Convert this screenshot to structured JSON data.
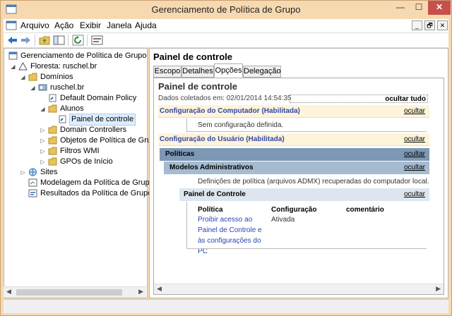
{
  "window": {
    "title": "Gerenciamento de Política de Grupo",
    "minimize": "—",
    "maximize": "☐",
    "close": "✕"
  },
  "menu": {
    "items": [
      "Arquivo",
      "Ação",
      "Exibir",
      "Janela",
      "Ajuda"
    ],
    "mdi_minimize": "_",
    "mdi_restore": "🗗",
    "mdi_close": "✕"
  },
  "tree": {
    "root": "Gerenciamento de Política de Grupo",
    "forest": "Floresta: ruschel.br",
    "domains": "Domínios",
    "domain": "ruschel.br",
    "default_policy": "Default Domain Policy",
    "alunos": "Alunos",
    "painel": "Painel de controle",
    "dc": "Domain Controllers",
    "objects": "Objetos de Política de Grup",
    "wmi": "Filtros WMI",
    "starter": "GPOs de Início",
    "sites": "Sites",
    "modeling": "Modelagem da Política de Grupo",
    "results": "Resultados da Política de Grupo"
  },
  "right": {
    "title": "Painel de controle",
    "tabs": [
      "Escopo",
      "Detalhes",
      "Opções",
      "Delegação"
    ],
    "active_tab": "Opções"
  },
  "report": {
    "title": "Painel de controle",
    "collected": "Dados coletados em: 02/01/2014 14:54:35",
    "hide_all": "ocultar tudo",
    "hide": "ocultar",
    "computer_config": "Configuração do Computador (Habilitada)",
    "no_config": "Sem configuração definida.",
    "user_config": "Configuração do Usuário (Habilitada)",
    "policies": "Políticas",
    "admin_models": "Modelos Administrativos",
    "admx_note": "Definições de política (arquivos ADMX) recuperadas do computador local.",
    "control_panel": "Painel de Controle",
    "col_policy": "Política",
    "col_setting": "Configuração",
    "col_comment": "comentário",
    "row_policy": "Proibir acesso ao Painel de Controle e às configurações do PC",
    "row_setting": "Ativada"
  },
  "colors": {
    "titlebar": "#f6d9b0",
    "close_button": "#c7504a",
    "link": "#2a44b5",
    "band_yellow": "#fdf4d9",
    "band_dark": "#7d98b4",
    "band_mid": "#a5bbd0",
    "band_light": "#dde6ef"
  }
}
